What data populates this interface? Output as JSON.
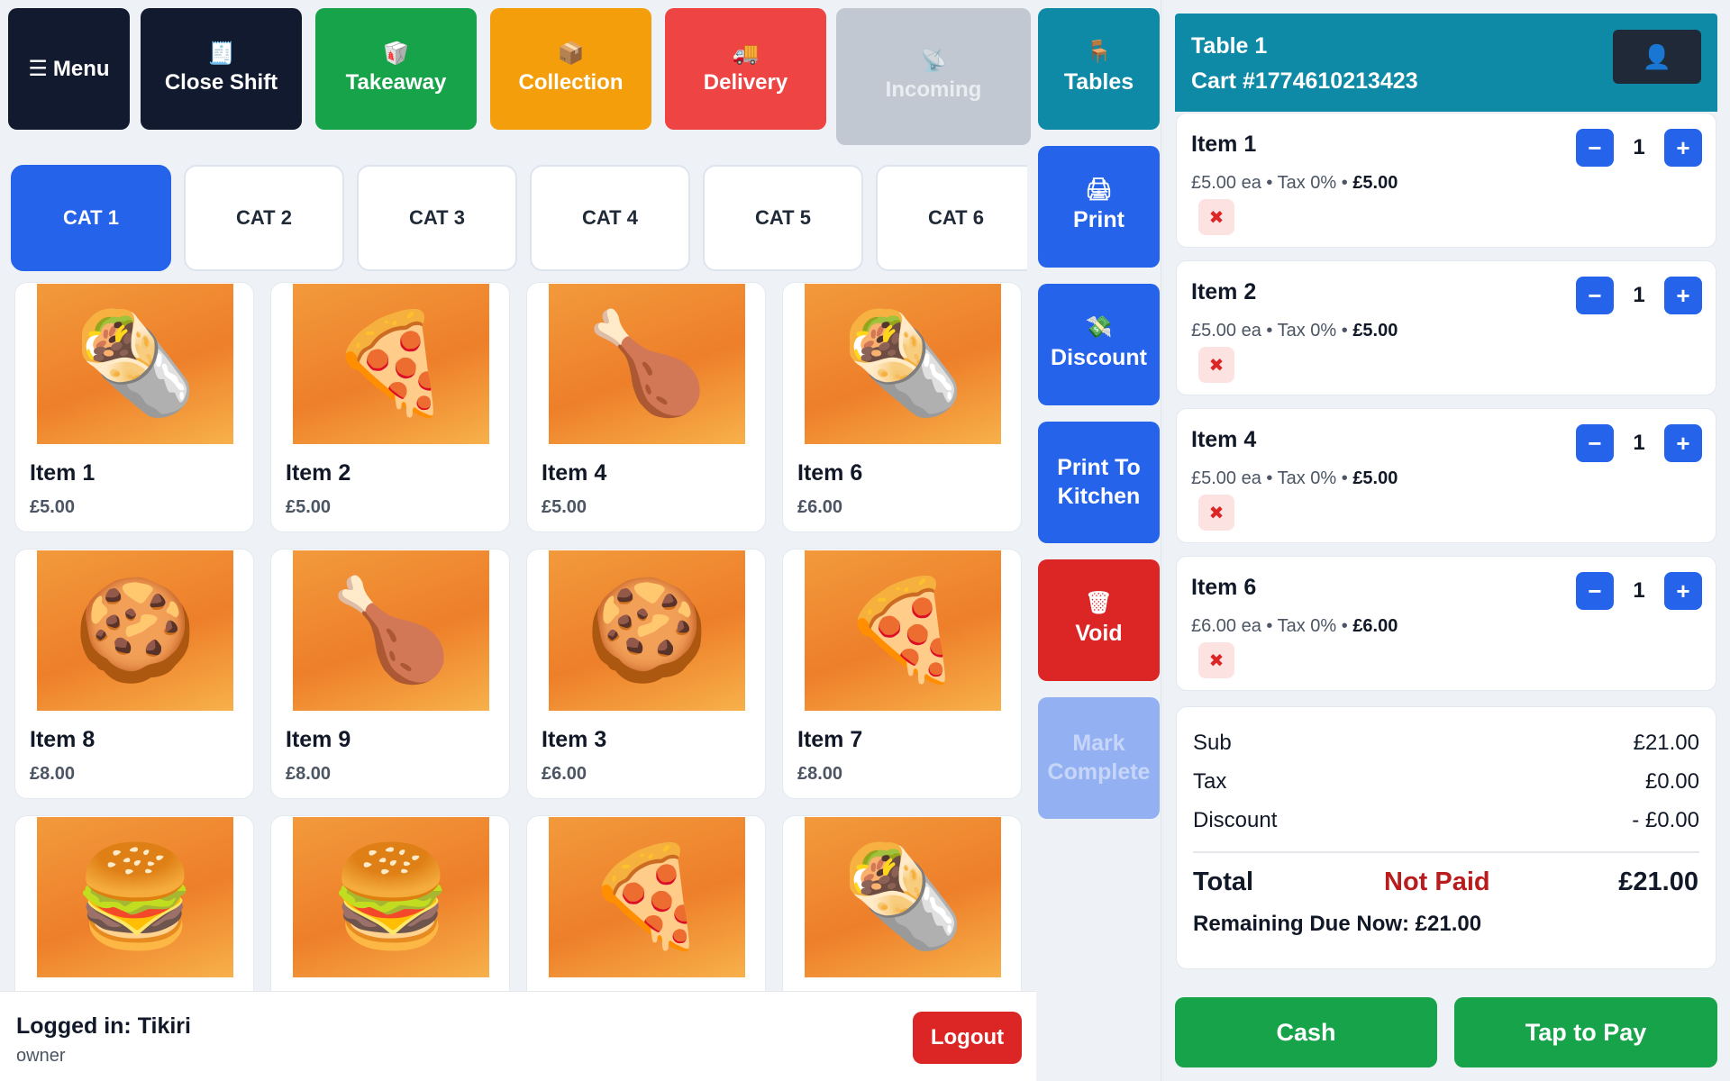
{
  "top_actions": {
    "menu": {
      "label": "Menu",
      "icon": "hamburger-icon"
    },
    "close_shift": {
      "label": "Close Shift",
      "icon": "receipt-icon"
    },
    "takeaway": {
      "label": "Takeaway",
      "icon": "takeout-box-icon"
    },
    "collection": {
      "label": "Collection",
      "icon": "package-icon"
    },
    "delivery": {
      "label": "Delivery",
      "icon": "truck-icon"
    },
    "incoming": {
      "label": "Incoming",
      "icon": "satellite-icon"
    }
  },
  "categories": [
    "CAT 1",
    "CAT 2",
    "CAT 3",
    "CAT 4",
    "CAT 5",
    "CAT 6"
  ],
  "active_category": "CAT 1",
  "products": [
    {
      "name": "Item 1",
      "price": "£5.00",
      "image": "burrito"
    },
    {
      "name": "Item 2",
      "price": "£5.00",
      "image": "pizza-slice"
    },
    {
      "name": "Item 4",
      "price": "£5.00",
      "image": "chicken-drumstick"
    },
    {
      "name": "Item 6",
      "price": "£6.00",
      "image": "burrito"
    },
    {
      "name": "Item 8",
      "price": "£8.00",
      "image": "chicken-nuggets"
    },
    {
      "name": "Item 9",
      "price": "£8.00",
      "image": "chicken-drumstick"
    },
    {
      "name": "Item 3",
      "price": "£6.00",
      "image": "chicken-nuggets"
    },
    {
      "name": "Item 7",
      "price": "£8.00",
      "image": "pizza-slice"
    },
    {
      "name": "",
      "price": "",
      "image": "burger"
    },
    {
      "name": "",
      "price": "",
      "image": "burger"
    },
    {
      "name": "",
      "price": "",
      "image": "pizza-slice"
    },
    {
      "name": "",
      "price": "",
      "image": "burrito"
    }
  ],
  "login": {
    "name": "Logged in: Tikiri",
    "role": "owner",
    "logout_label": "Logout"
  },
  "side_actions": {
    "tables": {
      "label": "Tables",
      "icon": "chair-icon"
    },
    "print": {
      "label": "Print",
      "icon": "printer-icon"
    },
    "discount": {
      "label": "Discount",
      "icon": "money-icon"
    },
    "print_kitchen": {
      "label": "Print To Kitchen"
    },
    "void": {
      "label": "Void",
      "icon": "trash-icon"
    },
    "mark_complete": {
      "label": "Mark Complete"
    }
  },
  "cart": {
    "table": "Table 1",
    "cart_id": "Cart #1774610213423",
    "user_icon": "user-icon",
    "lines": [
      {
        "name": "Item 1",
        "unit": "£5.00 ea • Tax 0% • ",
        "total": "£5.00",
        "qty": "1"
      },
      {
        "name": "Item 2",
        "unit": "£5.00 ea • Tax 0% • ",
        "total": "£5.00",
        "qty": "1"
      },
      {
        "name": "Item 4",
        "unit": "£5.00 ea • Tax 0% • ",
        "total": "£5.00",
        "qty": "1"
      },
      {
        "name": "Item 6",
        "unit": "£6.00 ea • Tax 0% • ",
        "total": "£6.00",
        "qty": "1"
      }
    ],
    "summary": {
      "sub_label": "Sub",
      "sub_value": "£21.00",
      "tax_label": "Tax",
      "tax_value": "£0.00",
      "discount_label": "Discount",
      "discount_value": "- £0.00",
      "total_label": "Total",
      "status": "Not Paid",
      "total_value": "£21.00",
      "remaining": "Remaining Due Now: £21.00"
    },
    "pay": {
      "cash": "Cash",
      "tap": "Tap to Pay"
    }
  },
  "colors": {
    "dark": "#111a2e",
    "green": "#16a34a",
    "orange": "#f59e0b",
    "red": "#ef4444",
    "blue": "#2563eb",
    "teal": "#0e8aa6",
    "disabled": "#c1c8d2"
  }
}
